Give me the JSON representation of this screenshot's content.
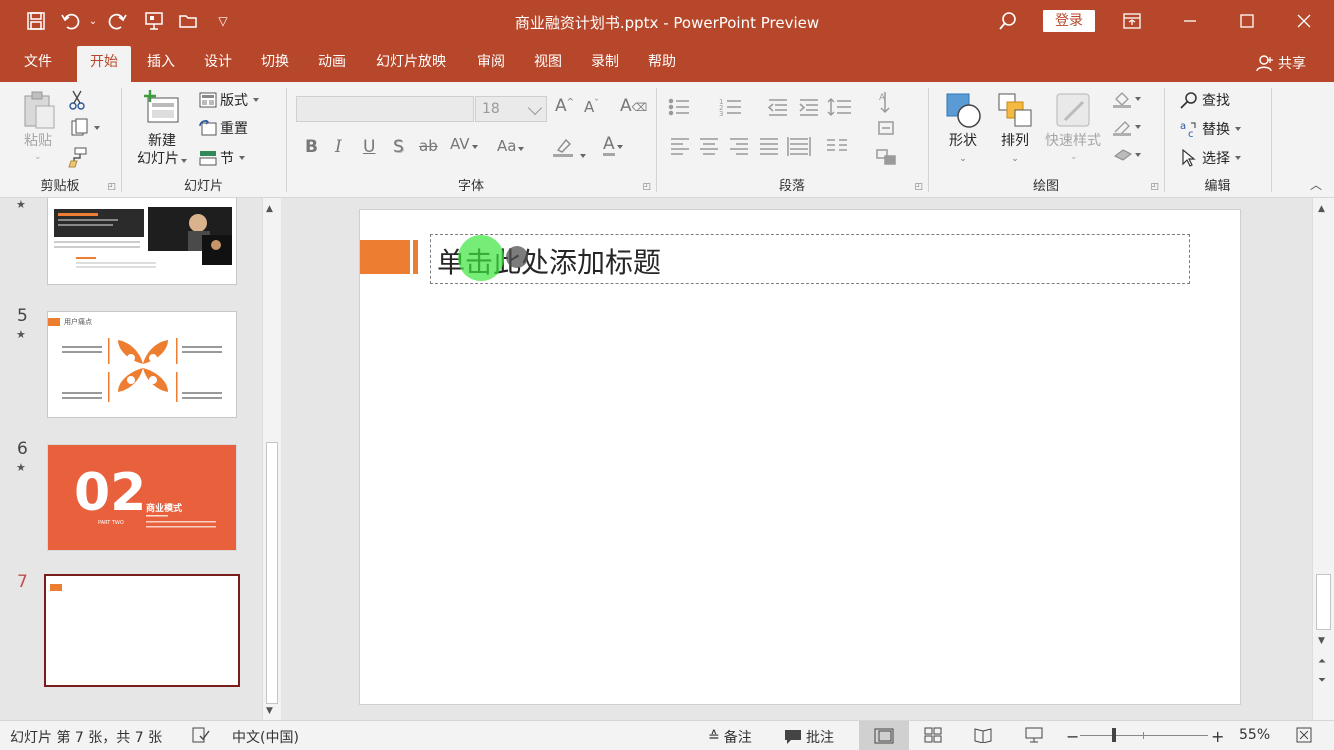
{
  "window": {
    "title": "商业融资计划书.pptx  -  PowerPoint Preview",
    "login": "登录"
  },
  "tabs": [
    "文件",
    "开始",
    "插入",
    "设计",
    "切换",
    "动画",
    "幻灯片放映",
    "审阅",
    "视图",
    "录制",
    "帮助"
  ],
  "active_tab": "开始",
  "share": "共享",
  "ribbon": {
    "clipboard": {
      "label": "剪贴板",
      "paste": "粘贴"
    },
    "slides": {
      "label": "幻灯片",
      "new_slide_line1": "新建",
      "new_slide_line2": "幻灯片",
      "layout": "版式",
      "reset": "重置",
      "section": "节"
    },
    "font": {
      "label": "字体",
      "font_name": "",
      "font_size": "18",
      "bold": "B",
      "italic": "I",
      "underline": "U",
      "shadow": "S",
      "strike": "ab",
      "spacing": "AV",
      "case": "Aa",
      "color": "A"
    },
    "paragraph": {
      "label": "段落"
    },
    "drawing": {
      "label": "绘图",
      "shapes": "形状",
      "arrange": "排列",
      "quick_styles": "快速样式"
    },
    "editing": {
      "label": "编辑",
      "find": "查找",
      "replace": "替换",
      "select": "选择"
    }
  },
  "thumbnails": [
    {
      "number": "",
      "starred": true,
      "kind": "photo"
    },
    {
      "number": "5",
      "starred": true,
      "kind": "diagram",
      "title": "用户痛点"
    },
    {
      "number": "6",
      "starred": true,
      "kind": "section",
      "big": "02",
      "heading": "商业模式",
      "sub": "PART TWO"
    },
    {
      "number": "7",
      "starred": false,
      "kind": "blank",
      "current": true
    }
  ],
  "slide": {
    "title_placeholder": "单击此处添加标题",
    "accent_color": "#ed7d31"
  },
  "status": {
    "slide_info": "幻灯片 第 7 张，共 7 张",
    "language": "中文(中国)",
    "notes": "备注",
    "comments": "批注",
    "zoom": "55%"
  },
  "colors": {
    "brand": "#b7472a",
    "current_thumb_border": "#7b1c1c"
  }
}
